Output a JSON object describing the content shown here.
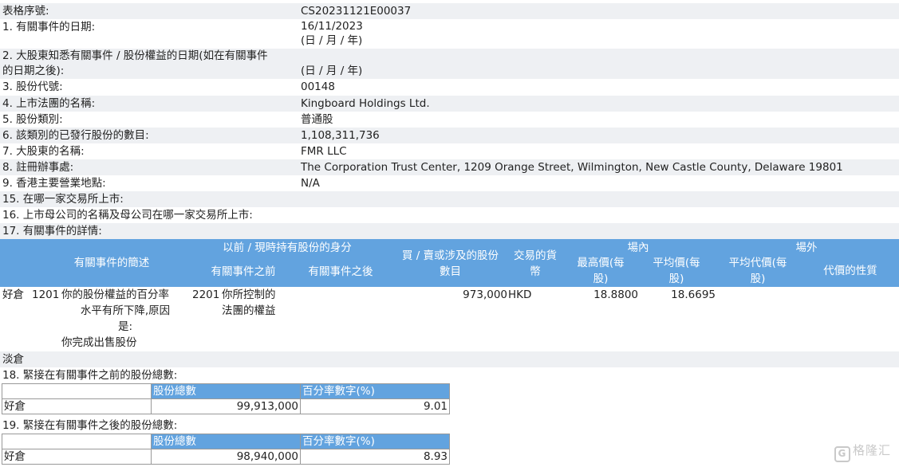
{
  "form": {
    "serial_label": "表格序號:",
    "serial_value": "CS20231121E00037",
    "q1_label": "1. 有關事件的日期:",
    "q1_value": "16/11/2023",
    "q1_format": "(日 / 月 / 年)",
    "q2_label_line1": "2. 大股東知悉有關事件 / 股份權益的日期(如在有關事件",
    "q2_label_line2": "的日期之後):",
    "q2_format": "(日 / 月 / 年)",
    "q3_label": "3. 股份代號:",
    "q3_value": "00148",
    "q4_label": "4. 上市法團的名稱:",
    "q4_value": "Kingboard Holdings Ltd.",
    "q5_label": "5. 股份類別:",
    "q5_value": "普通股",
    "q6_label": "6. 該類別的已發行股份的數目:",
    "q6_value": "1,108,311,736",
    "q7_label": "7. 大股東的名稱:",
    "q7_value": "FMR LLC",
    "q8_label": "8. 註冊辦事處:",
    "q8_value": "The Corporation Trust Center, 1209 Orange Street, Wilmington, New Castle County, Delaware 19801",
    "q9_label": "9. 香港主要營業地點:",
    "q9_value": "N/A",
    "q15_label": "15. 在哪一家交易所上市:",
    "q16_label": "16. 上市母公司的名稱及母公司在哪一家交易所上市:",
    "q17_label": "17. 有關事件的詳情:"
  },
  "details_header": {
    "event_desc": "有關事件的簡述",
    "capacity_group": "以前 / 現時持有股份的身分",
    "before": "有關事件之前",
    "after": "有關事件之後",
    "shares_line1": "買 / 賣或涉及的股份",
    "shares_line2": "數目",
    "currency_line1": "交易的貨",
    "currency_line2": "幣",
    "on_exchange": "場內",
    "highest_line1": "最高價(每",
    "highest_line2": "股)",
    "avg_line1": "平均價(每",
    "avg_line2": "股)",
    "off_exchange": "場外",
    "off_avg_line1": "平均代價(每",
    "off_avg_line2": "股)",
    "consideration_nature": "代價的性質"
  },
  "details_row": {
    "position": "好倉",
    "event_code": "1201",
    "event_text_line1": "你的股份權益的百分率",
    "event_text_line2": "水平有所下降,原因",
    "event_text_line3": "是:",
    "event_text_line4": "你完成出售股份",
    "capacity_code": "2201",
    "capacity_line1": "你所控制的",
    "capacity_line2": "法團的權益",
    "shares": "973,000",
    "currency": "HKD",
    "highest_price": "18.8800",
    "average_price": "18.6695"
  },
  "short_label": "淡倉",
  "q18": {
    "label": "18. 緊接在有關事件之前的股份總數:",
    "col_shares": "股份總數",
    "col_pct": "百分率數字(%)",
    "row_label": "好倉",
    "shares": "99,913,000",
    "pct": "9.01"
  },
  "q19": {
    "label": "19. 緊接在有關事件之後的股份總數:",
    "col_shares": "股份總數",
    "col_pct": "百分率數字(%)",
    "row_label": "好倉",
    "shares": "98,940,000",
    "pct": "8.93"
  },
  "watermark": {
    "icon": "G",
    "text": "格隆汇"
  },
  "colors": {
    "header_blue": "#62a3df",
    "row_shade": "#eef0f3"
  }
}
